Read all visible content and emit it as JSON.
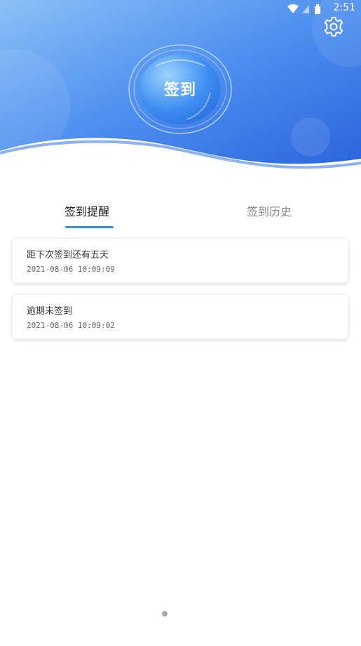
{
  "status_bar": {
    "time": "2:51",
    "icons": [
      "wifi-icon",
      "signal-icon",
      "battery-icon"
    ]
  },
  "header": {
    "checkin_button_label": "签到",
    "settings_icon": "gear-icon"
  },
  "tabs": [
    {
      "label": "签到提醒",
      "active": true
    },
    {
      "label": "签到历史",
      "active": false
    }
  ],
  "records": [
    {
      "title": "距下次签到还有五天",
      "time": "2021-08-06 10:09:09"
    },
    {
      "title": "逾期未签到",
      "time": "2021-08-06 10:09:02"
    }
  ],
  "pager": {
    "active_index": 0
  },
  "colors": {
    "header_blue_light": "#7fb4f1",
    "header_blue_dark": "#2f6fe0",
    "tab_underline": "#3c8ed8"
  }
}
